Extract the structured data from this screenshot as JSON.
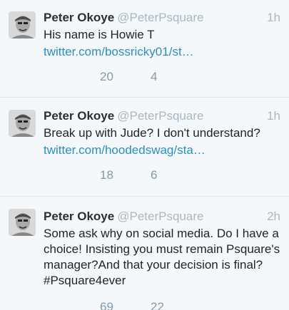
{
  "tweets": [
    {
      "name": "Peter Okoye",
      "handle": "@PeterPsquare",
      "time": "1h",
      "text": "His name is Howie T",
      "link": "twitter.com/bossricky01/st…",
      "retweets": "20",
      "favorites": "4"
    },
    {
      "name": "Peter Okoye",
      "handle": "@PeterPsquare",
      "time": "1h",
      "text": "Break up with Jude? I don't understand?",
      "link": "twitter.com/hoodedswag/sta…",
      "retweets": "18",
      "favorites": "6"
    },
    {
      "name": "Peter Okoye",
      "handle": "@PeterPsquare",
      "time": "2h",
      "text": "Some ask why on social media. Do I have a choice! Insisting you must remain Psquare's manager?And that your decision is final? #Psquare4ever",
      "retweets": "69",
      "favorites": "22"
    }
  ],
  "colors": {
    "background": "#f5f8fa",
    "name": "#292f33",
    "meta": "#aab8c2",
    "link": "#2a8fbd"
  }
}
